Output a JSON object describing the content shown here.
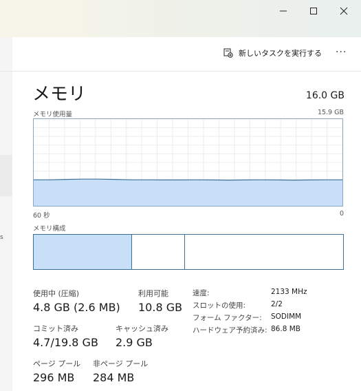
{
  "toolbar": {
    "run_task_label": "新しいタスクを実行する",
    "more_label": "···"
  },
  "memory": {
    "title": "メモリ",
    "total": "16.0 GB",
    "usage_label": "メモリ使用量",
    "usage_max": "15.9 GB",
    "time_left": "60 秒",
    "time_right": "0",
    "composition_label": "メモリ構成",
    "usage_fraction": 0.3
  },
  "stats": {
    "in_use_label": "使用中 (圧縮)",
    "in_use_value": "4.8 GB (2.6 MB)",
    "available_label": "利用可能",
    "available_value": "10.8 GB",
    "committed_label": "コミット済み",
    "committed_value": "4.7/19.8 GB",
    "cached_label": "キャッシュ済み",
    "cached_value": "2.9 GB",
    "paged_label": "ページ プール",
    "paged_value": "296 MB",
    "nonpaged_label": "非ページ プール",
    "nonpaged_value": "284 MB"
  },
  "details": [
    {
      "key": "速度:",
      "value": "2133 MHz"
    },
    {
      "key": "スロットの使用:",
      "value": "2/2"
    },
    {
      "key": "フォーム ファクター:",
      "value": "SODIMM"
    },
    {
      "key": "ハードウェア予約済み:",
      "value": "86.8 MB"
    }
  ],
  "colors": {
    "graph_fill": "#c7dff7",
    "graph_line": "#3d6e96",
    "grid": "#e8edf2"
  }
}
